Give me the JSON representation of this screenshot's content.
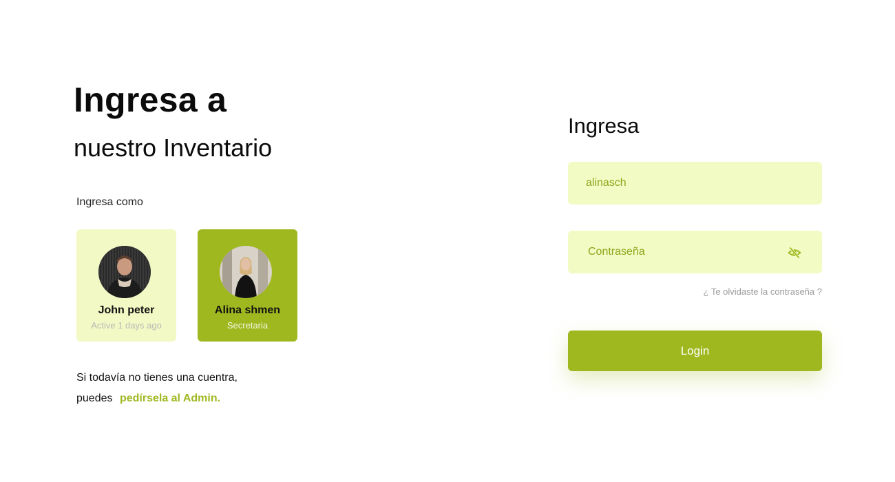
{
  "hero": {
    "title_line1": "Ingresa a",
    "title_line2": "nuestro Inventario"
  },
  "login_as": {
    "label": "Ingresa como",
    "users": [
      {
        "name": "John peter",
        "status": "Active 1 days ago",
        "selected": false
      },
      {
        "name": "Alina shmen",
        "status": "Secretaria",
        "selected": true
      }
    ]
  },
  "signup": {
    "line1": "Si todavía no tienes una cuentra,",
    "line2_prefix": "puedes",
    "link": "pedírsela al Admin."
  },
  "form": {
    "title": "Ingresa",
    "username_value": "alinasch",
    "password_placeholder": "Contraseña",
    "forgot_link": "¿ Te olvidaste la contraseña ?",
    "login_button": "Login"
  },
  "icons": {
    "password_toggle": "eye-off-icon"
  },
  "colors": {
    "accent": "#a0b820",
    "accent_light": "#f2fbc4",
    "input_text": "#8ca51a",
    "muted": "#9a9a9a"
  }
}
